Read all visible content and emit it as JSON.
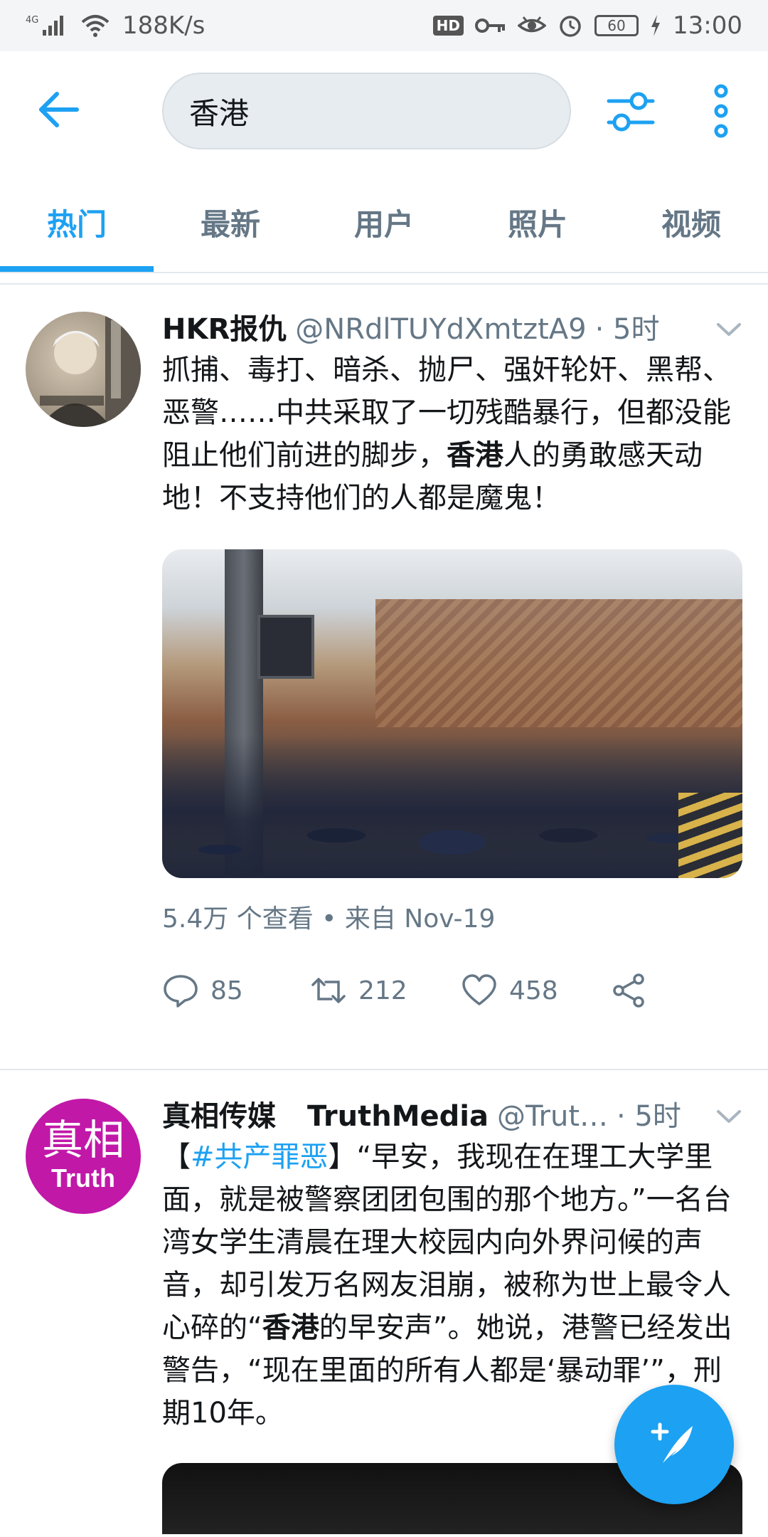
{
  "status_bar": {
    "network": "4G",
    "speed": "188K/s",
    "hd": "HD",
    "battery": "60",
    "time": "13:00"
  },
  "search": {
    "query": "香港"
  },
  "tabs": [
    {
      "label": "热门",
      "active": true
    },
    {
      "label": "最新",
      "active": false
    },
    {
      "label": "用户",
      "active": false
    },
    {
      "label": "照片",
      "active": false
    },
    {
      "label": "视频",
      "active": false
    }
  ],
  "tweets": [
    {
      "author": "HKR报仇",
      "handle": "@NRdlTUYdXmtztA9",
      "time": "· 5时",
      "text_before": "抓捕、毒打、暗杀、抛尸、强奸轮奸、黑帮、恶警……中共采取了一切残酷暴行，但都没能阻止他们前进的脚步，",
      "text_highlight": "香港",
      "text_after": "人的勇敢感天动地！不支持他们的人都是魔鬼！",
      "media_meta": "5.4万 个查看 • 来自 Nov-19",
      "replies": "85",
      "retweets": "212",
      "likes": "458"
    },
    {
      "author": "真相传媒",
      "author2": "TruthMedia",
      "handle": "@Trut…",
      "time": "· 5时",
      "text_open": "【",
      "hashtag": "#共产罪恶",
      "text_before": "】“早安，我现在在理工大学里面，就是被警察团团包围的那个地方。”一名台湾女学生清晨在理大校园内向外界问候的声音，却引发万名网友泪崩，被称为世上最令人心碎的“",
      "text_highlight": "香港",
      "text_after": "的早安声”。她说，港警已经发出警告，“现在里面的所有人都是‘暴动罪’”，刑期10年。",
      "avatar_text_cn": "真相",
      "avatar_text_en": "Truth"
    }
  ],
  "colors": {
    "accent": "#1da1f2",
    "text": "#14171a",
    "secondary": "#657786",
    "avatar_truth": "#c118a8"
  }
}
